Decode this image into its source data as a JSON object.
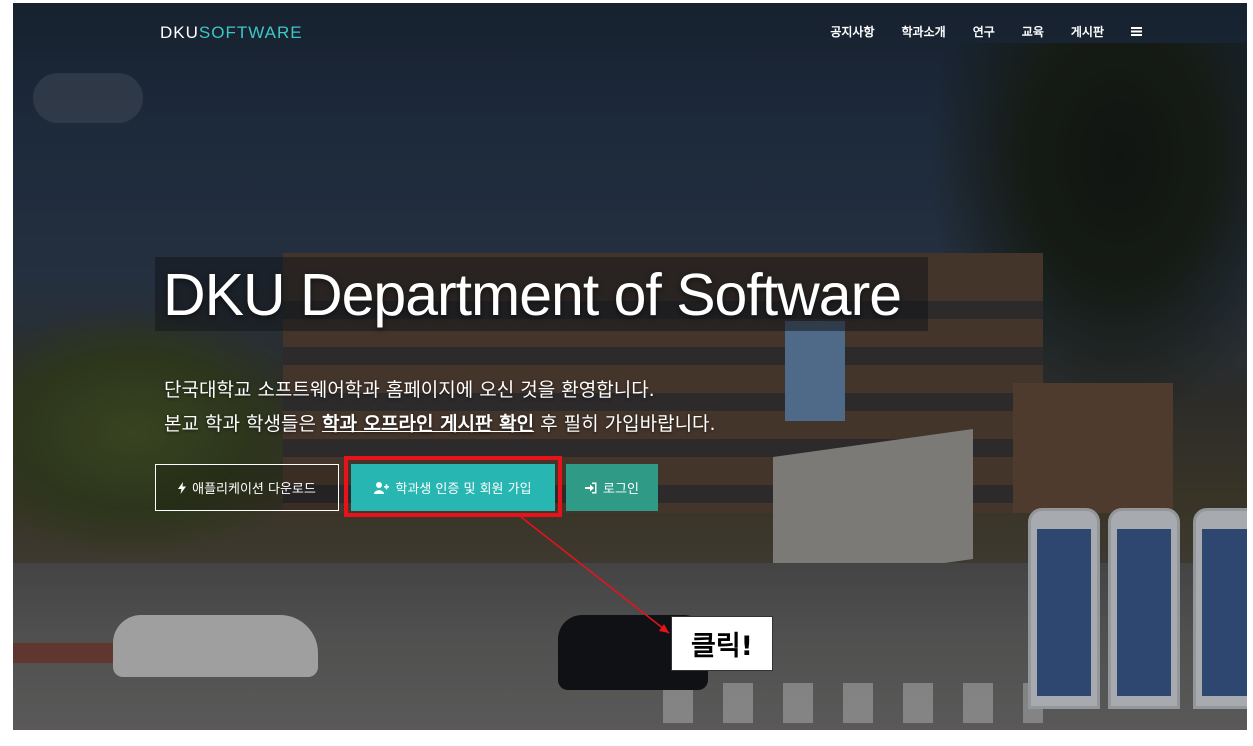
{
  "brand": {
    "part1": "DKU",
    "part2": "SOFTWARE"
  },
  "nav": {
    "items": [
      "공지사항",
      "학과소개",
      "연구",
      "교육",
      "게시판"
    ],
    "menu_icon": "hamburger-icon"
  },
  "hero": {
    "title": "DKU Department of Software",
    "line1": "단국대학교 소프트웨어학과 홈페이지에 오신 것을 환영합니다.",
    "line2_pre": "본교 학과 학생들은 ",
    "line2_em": "학과 오프라인 게시판 확인",
    "line2_post": " 후 필히 가입바랍니다."
  },
  "buttons": {
    "app": {
      "label": "애플리케이션 다운로드",
      "icon": "bolt-icon"
    },
    "join": {
      "label": "학과생 인증 및 회원 가입",
      "icon": "user-plus-icon"
    },
    "login": {
      "label": "로그인",
      "icon": "sign-in-icon"
    }
  },
  "annotation": {
    "callout": "클릭!",
    "highlight_color": "#e8121a"
  },
  "colors": {
    "accent": "#3ec6c4",
    "join_bg": "#27b6b2",
    "login_bg": "#2f9a86"
  }
}
